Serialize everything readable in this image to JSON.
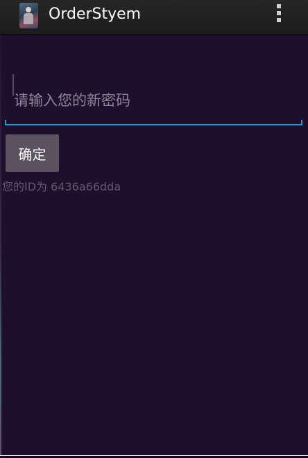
{
  "action_bar": {
    "title": "OrderStyem",
    "app_icon": "app-launcher-icon",
    "overflow_icon": "overflow-menu-icon"
  },
  "form": {
    "password_placeholder": "请输入您的新密码",
    "password_value": "",
    "confirm_label": "确定"
  },
  "info": {
    "id_text": "您的ID为 6436a66dda"
  },
  "colors": {
    "background": "#1e0f2e",
    "action_bar": "#212121",
    "accent": "#1e9bd6",
    "button": "#5b5260",
    "info_text": "#63596b"
  }
}
